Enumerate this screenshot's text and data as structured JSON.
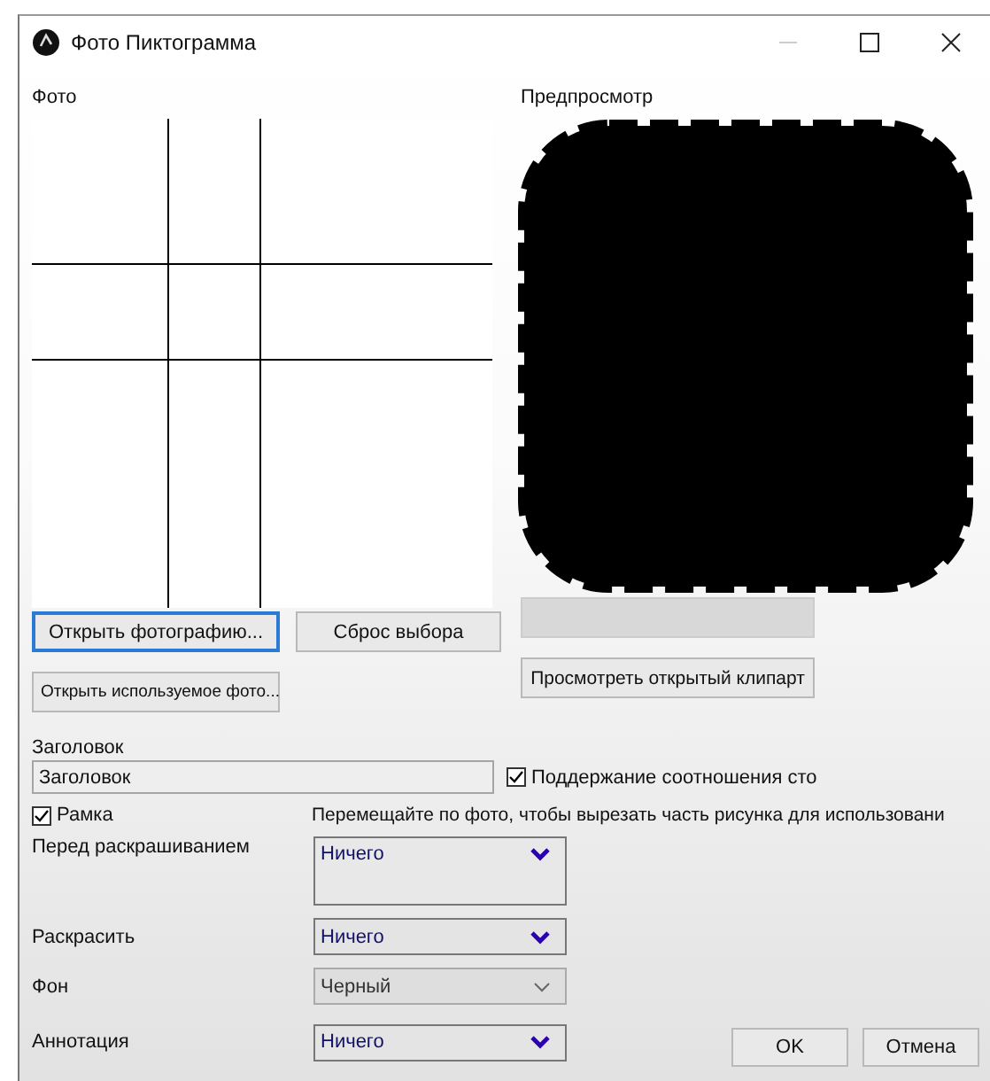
{
  "window": {
    "title": "Фото Пиктограмма"
  },
  "photo": {
    "label": "Фото"
  },
  "preview": {
    "label": "Предпросмотр"
  },
  "photo_buttons": [
    {
      "label": "Открыть фотографию...",
      "focused": true
    },
    {
      "label": "Сброс выбора",
      "focused": false
    },
    {
      "label": "Открыть используемое фото...",
      "focused": false
    }
  ],
  "preview_buttons": [
    {
      "disabled": true
    },
    {
      "label": "Просмотреть открытый клипарт",
      "disabled": false
    }
  ],
  "title_field": {
    "label": "Заголовок",
    "value": "Заголовок"
  },
  "keep_ratio": {
    "label": "Поддержание соотношения сто",
    "checked": true
  },
  "frame": {
    "label": "Рамка",
    "checked": true
  },
  "hint": "Перемещайте по фото, чтобы вырезать часть рисунка для использовани",
  "selects": [
    {
      "kind": "listbox",
      "label": "Перед раскрашиванием",
      "value": "Ничего",
      "disabled": false
    },
    {
      "kind": "dropdown",
      "label": "Раскрасить",
      "value": "Ничего",
      "disabled": false
    },
    {
      "kind": "dropdown",
      "label": "Фон",
      "value": "Черный",
      "disabled": true
    },
    {
      "kind": "dropdown",
      "label": "Аннотация",
      "value": "Ничего",
      "disabled": false
    }
  ],
  "dialog_buttons": [
    "OK",
    "Отмена"
  ]
}
